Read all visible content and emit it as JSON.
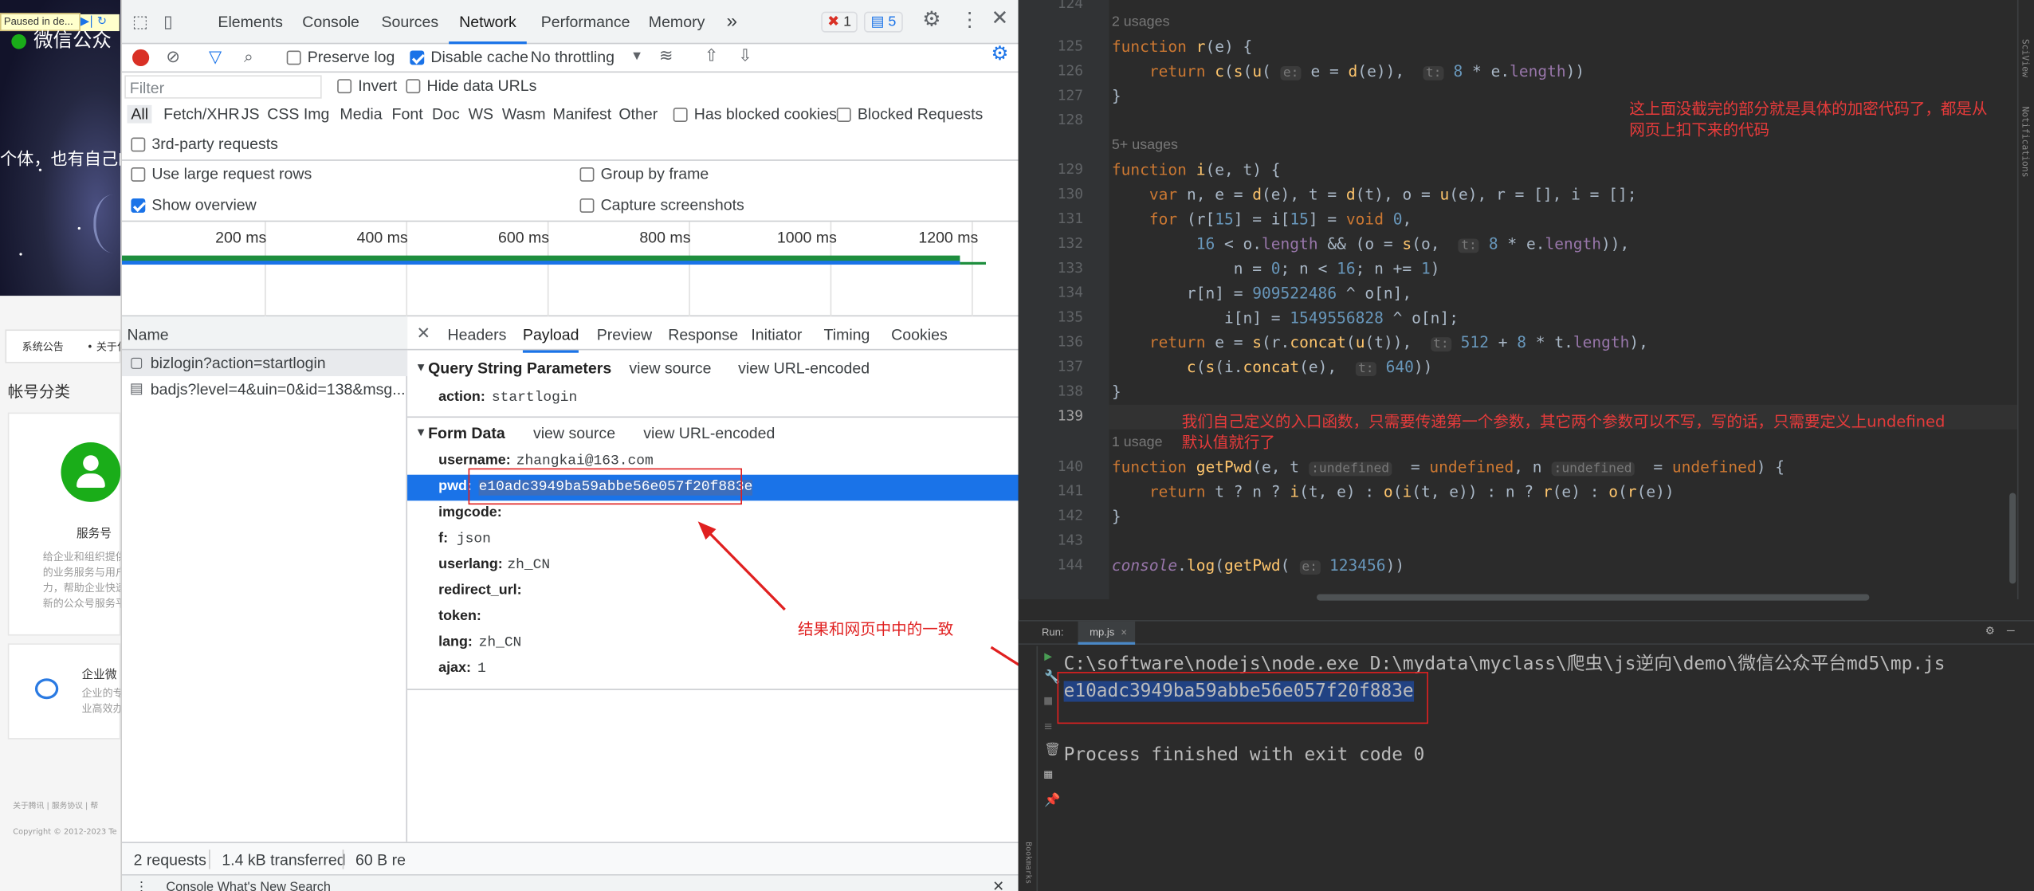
{
  "webpage": {
    "paused_badge": "Paused in de...",
    "site_title": "微信公众",
    "banner_text": "个体，也有自己的",
    "subnav": [
      "系统公告",
      "• 关于化"
    ],
    "section_title": "帐号分类",
    "service_title": "服务号",
    "service_desc": [
      "给企业和组织提供",
      "的业务服务与用户",
      "力，帮助企业快速",
      "新的公众号服务平"
    ],
    "enterprise_title": "企业微",
    "enterprise_desc": [
      "企业的专",
      "业高效办"
    ],
    "footer_links": "关于腾讯 | 服务协议 | 帮",
    "copyright": "Copyright © 2012-2023 Te"
  },
  "devtools": {
    "main_tabs": [
      "Elements",
      "Console",
      "Sources",
      "Network",
      "Performance",
      "Memory"
    ],
    "active_tab": "Network",
    "more_tabs": "»",
    "error_count": "1",
    "message_count": "5",
    "toolbar": {
      "preserve_log": "Preserve log",
      "disable_cache": "Disable cache",
      "throttling": "No throttling"
    },
    "filter": {
      "placeholder": "Filter",
      "invert": "Invert",
      "hide_data_urls": "Hide data URLs"
    },
    "type_filters": [
      "All",
      "Fetch/XHR",
      "JS",
      "CSS",
      "Img",
      "Media",
      "Font",
      "Doc",
      "WS",
      "Wasm",
      "Manifest",
      "Other"
    ],
    "has_blocked_cookies": "Has blocked cookies",
    "blocked_requests": "Blocked Requests",
    "third_party": "3rd-party requests",
    "options": {
      "large_rows": "Use large request rows",
      "group_by_frame": "Group by frame",
      "show_overview": "Show overview",
      "capture_screenshots": "Capture screenshots"
    },
    "timeline_ticks": [
      "200 ms",
      "400 ms",
      "600 ms",
      "800 ms",
      "1000 ms",
      "1200 ms"
    ],
    "name_header": "Name",
    "requests": [
      "bizlogin?action=startlogin",
      "badjs?level=4&uin=0&id=138&msg..."
    ],
    "detail_tabs": [
      "Headers",
      "Payload",
      "Preview",
      "Response",
      "Initiator",
      "Timing",
      "Cookies"
    ],
    "active_detail_tab": "Payload",
    "query_section": {
      "title": "Query String Parameters",
      "view_source": "view source",
      "view_url_encoded": "view URL-encoded",
      "params": [
        {
          "key": "action:",
          "value": "startlogin"
        }
      ]
    },
    "form_section": {
      "title": "Form Data",
      "view_source": "view source",
      "view_url_encoded": "view URL-encoded",
      "params": [
        {
          "key": "username:",
          "value": "zhangkai@163.com"
        },
        {
          "key": "pwd:",
          "value": "e10adc3949ba59abbe56e057f20f883e"
        },
        {
          "key": "imgcode:",
          "value": ""
        },
        {
          "key": "f:",
          "value": "json"
        },
        {
          "key": "userlang:",
          "value": "zh_CN"
        },
        {
          "key": "redirect_url:",
          "value": ""
        },
        {
          "key": "token:",
          "value": ""
        },
        {
          "key": "lang:",
          "value": "zh_CN"
        },
        {
          "key": "ajax:",
          "value": "1"
        }
      ]
    },
    "status_bar": {
      "requests": "2 requests",
      "transferred": "1.4 kB transferred",
      "resources": "60 B re"
    },
    "drawer_tabs": "Console   What's New   Search"
  },
  "annotation_match": "结果和网页中中的一致",
  "ide": {
    "usage_lines": {
      "u1": "2 usages",
      "u2": "5+ usages",
      "u3": "1 usage"
    },
    "note_top": [
      "这上面没截完的部分就是具体的加密代码了，都是从",
      "网页上扣下来的代码"
    ],
    "note_bottom": [
      "我们自己定义的入口函数，只需要传递第一个参数，其它两个参数可以不写，写的话，只需要定义上undefined",
      "默认值就行了"
    ],
    "line_numbers": [
      "124",
      "125",
      "126",
      "127",
      "128",
      "129",
      "130",
      "131",
      "132",
      "133",
      "134",
      "135",
      "136",
      "137",
      "138",
      "139",
      "140",
      "141",
      "142",
      "143",
      "144"
    ],
    "run_label": "Run:",
    "run_file": "mp.js",
    "console": {
      "command": "C:\\software\\nodejs\\node.exe D:\\mydata\\myclass\\爬虫\\js逆向\\demo\\微信公众平台md5\\mp.js",
      "result": "e10adc3949ba59abbe56e057f20f883e",
      "finished": "Process finished with exit code 0"
    },
    "side_labels": {
      "sciview": "SciView",
      "notifications": "Notifications",
      "bookmarks": "Bookmarks"
    }
  }
}
